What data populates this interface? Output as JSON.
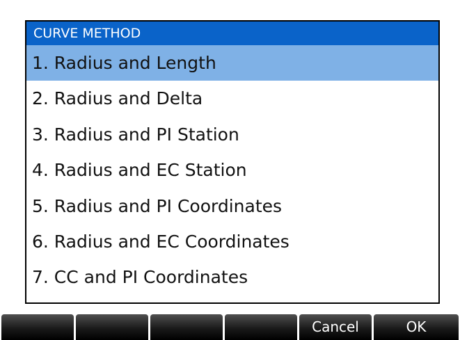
{
  "dialog": {
    "title": "CURVE METHOD",
    "selected_index": 0,
    "items": [
      {
        "label": "1. Radius and Length"
      },
      {
        "label": "2. Radius and Delta"
      },
      {
        "label": "3. Radius and PI Station"
      },
      {
        "label": "4. Radius and EC Station"
      },
      {
        "label": "5. Radius and PI Coordinates"
      },
      {
        "label": "6. Radius and EC Coordinates"
      },
      {
        "label": "7. CC and PI Coordinates"
      }
    ]
  },
  "softkeys": [
    {
      "label": ""
    },
    {
      "label": ""
    },
    {
      "label": ""
    },
    {
      "label": ""
    },
    {
      "label": "Cancel"
    },
    {
      "label": "OK"
    }
  ],
  "colors": {
    "title_bar": "#0a63c9",
    "selection": "#7fb1e6",
    "softkey": "#1a1a1a"
  }
}
